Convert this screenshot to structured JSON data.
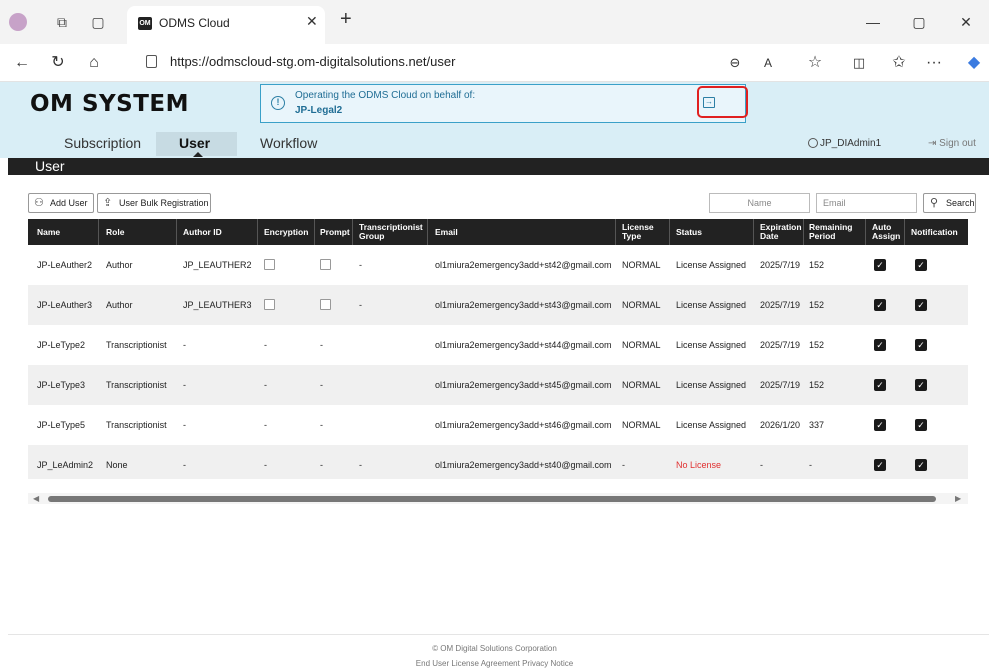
{
  "browser": {
    "tab_title": "ODMS Cloud",
    "favicon_text": "OM",
    "url_host": "https://odmscloud-stg.om-digitalsolutions.net",
    "url_path": "/user"
  },
  "header": {
    "logo": "OM SYSTEM",
    "banner_line1": "Operating the ODMS Cloud on behalf of:",
    "banner_line2": "JP-Legal2"
  },
  "nav": {
    "tabs": [
      "Subscription",
      "User",
      "Workflow"
    ],
    "user": "JP_DIAdmin1",
    "signout": "Sign out"
  },
  "page": {
    "title": "User"
  },
  "toolbar": {
    "add_user": "Add User",
    "bulk": "User Bulk Registration",
    "name_placeholder": "Name",
    "email_placeholder": "Email",
    "search": "Search"
  },
  "table": {
    "columns": [
      "Name",
      "Role",
      "Author ID",
      "Encryption",
      "Prompt",
      "Transcriptionist Group",
      "Email",
      "License Type",
      "Status",
      "Expiration Date",
      "Remaining Period",
      "Auto Assign",
      "Notification"
    ],
    "rows": [
      {
        "name": "JP-LeAuther2",
        "role": "Author",
        "author_id": "JP_LEAUTHER2",
        "encryption": "checkbox",
        "prompt": "checkbox",
        "group": "-",
        "email": "ol1miura2emergency3add+st42@gmail.com",
        "license": "NORMAL",
        "status": "License Assigned",
        "expiration": "2025/7/19",
        "remaining": "152",
        "auto_assign": true,
        "notification": true
      },
      {
        "name": "JP-LeAuther3",
        "role": "Author",
        "author_id": "JP_LEAUTHER3",
        "encryption": "checkbox",
        "prompt": "checkbox",
        "group": "-",
        "email": "ol1miura2emergency3add+st43@gmail.com",
        "license": "NORMAL",
        "status": "License Assigned",
        "expiration": "2025/7/19",
        "remaining": "152",
        "auto_assign": true,
        "notification": true
      },
      {
        "name": "JP-LeType2",
        "role": "Transcriptionist",
        "author_id": "-",
        "encryption": "-",
        "prompt": "-",
        "group": "",
        "email": "ol1miura2emergency3add+st44@gmail.com",
        "license": "NORMAL",
        "status": "License Assigned",
        "expiration": "2025/7/19",
        "remaining": "152",
        "auto_assign": true,
        "notification": true
      },
      {
        "name": "JP-LeType3",
        "role": "Transcriptionist",
        "author_id": "-",
        "encryption": "-",
        "prompt": "-",
        "group": "",
        "email": "ol1miura2emergency3add+st45@gmail.com",
        "license": "NORMAL",
        "status": "License Assigned",
        "expiration": "2025/7/19",
        "remaining": "152",
        "auto_assign": true,
        "notification": true
      },
      {
        "name": "JP-LeType5",
        "role": "Transcriptionist",
        "author_id": "-",
        "encryption": "-",
        "prompt": "-",
        "group": "",
        "email": "ol1miura2emergency3add+st46@gmail.com",
        "license": "NORMAL",
        "status": "License Assigned",
        "expiration": "2026/1/20",
        "remaining": "337",
        "auto_assign": true,
        "notification": true
      },
      {
        "name": "JP_LeAdmin2",
        "role": "None",
        "author_id": "-",
        "encryption": "-",
        "prompt": "-",
        "group": "-",
        "email": "ol1miura2emergency3add+st40@gmail.com",
        "license": "-",
        "status": "No License",
        "status_color": "#e03030",
        "expiration": "-",
        "remaining": "-",
        "auto_assign": true,
        "notification": true
      }
    ]
  },
  "footer": {
    "copyright": "© OM Digital Solutions Corporation",
    "links": "End User License Agreement   Privacy Notice"
  }
}
